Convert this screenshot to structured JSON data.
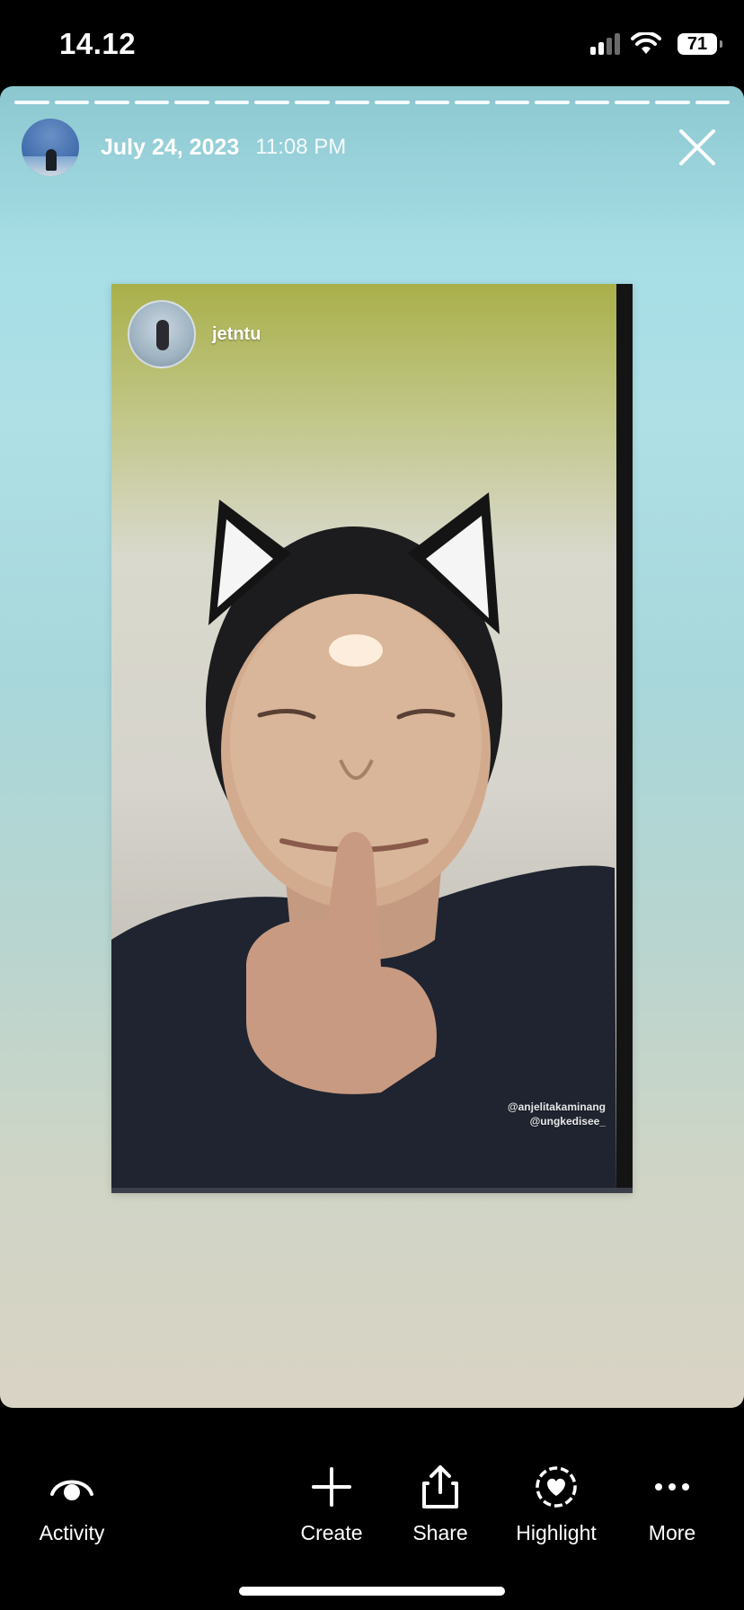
{
  "status_bar": {
    "time": "14.12",
    "battery": "71"
  },
  "story": {
    "date": "July 24, 2023",
    "time": "11:08 PM",
    "progress_segments": 18
  },
  "shared_post": {
    "username": "jetntu",
    "credit_lines": [
      "@anjelitakaminang",
      "@ungkedisee_"
    ]
  },
  "toolbar": {
    "activity_label": "Activity",
    "create_label": "Create",
    "share_label": "Share",
    "highlight_label": "Highlight",
    "more_label": "More"
  },
  "icons": {
    "close": "close-icon",
    "activity": "eye-icon",
    "create": "plus-icon",
    "share": "share-icon",
    "highlight": "heart-circle-icon",
    "more": "more-dots-icon"
  }
}
